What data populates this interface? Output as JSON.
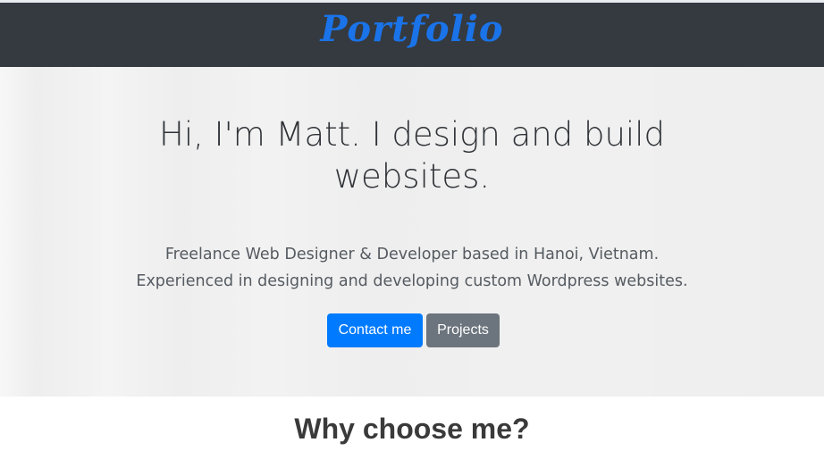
{
  "navbar": {
    "brand": "Portfolio"
  },
  "hero": {
    "title": "Hi, I'm Matt. I design and build websites.",
    "description_line1": "Freelance Web Designer & Developer based in Hanoi, Vietnam.",
    "description_line2": "Experienced in designing and developing custom Wordpress websites.",
    "contact_button": "Contact me",
    "projects_button": "Projects"
  },
  "section": {
    "heading": "Why choose me?"
  },
  "colors": {
    "navbar_bg": "#343a40",
    "brand": "#1a73e8",
    "primary": "#007bff",
    "secondary": "#6c757d"
  }
}
